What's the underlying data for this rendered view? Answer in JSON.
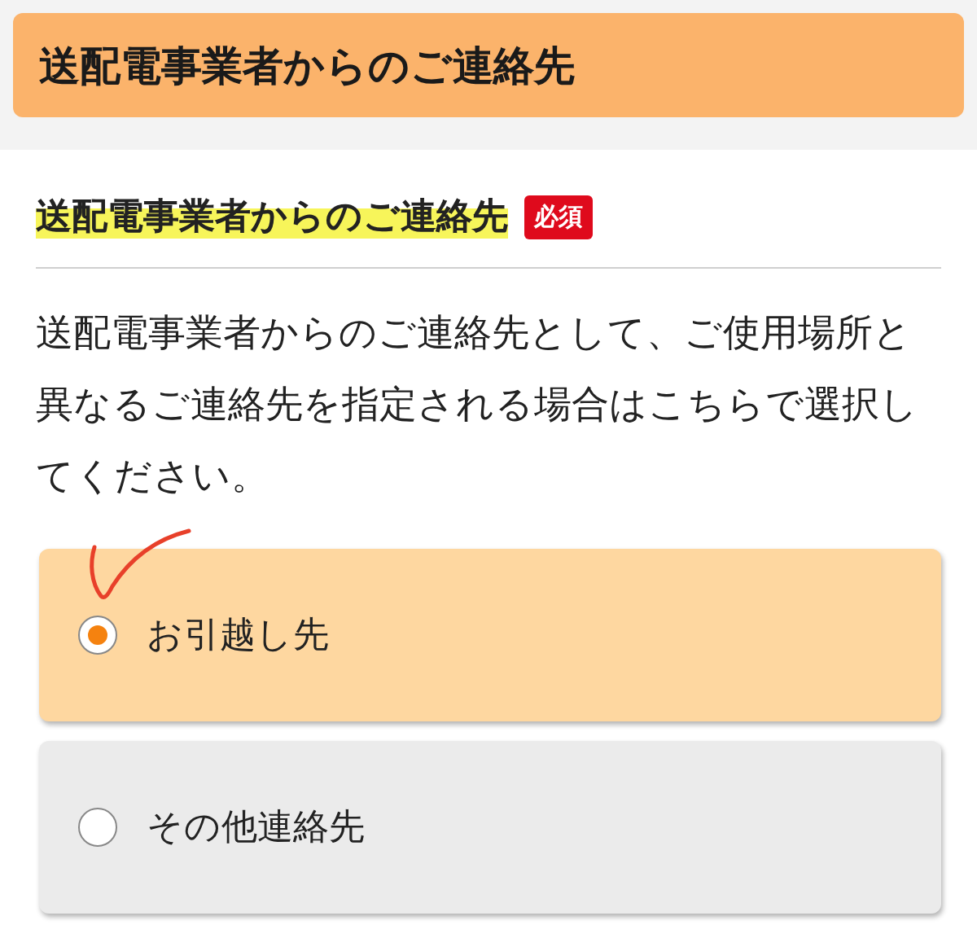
{
  "header": {
    "title": "送配電事業者からのご連絡先"
  },
  "section": {
    "heading": "送配電事業者からのご連絡先",
    "highlighted": true,
    "badge": "必須",
    "description": "送配電事業者からのご連絡先として、ご使用場所と異なるご連絡先を指定される場合はこちらで選択してください。"
  },
  "options": [
    {
      "label": "お引越し先",
      "selected": true
    },
    {
      "label": "その他連絡先",
      "selected": false
    }
  ]
}
